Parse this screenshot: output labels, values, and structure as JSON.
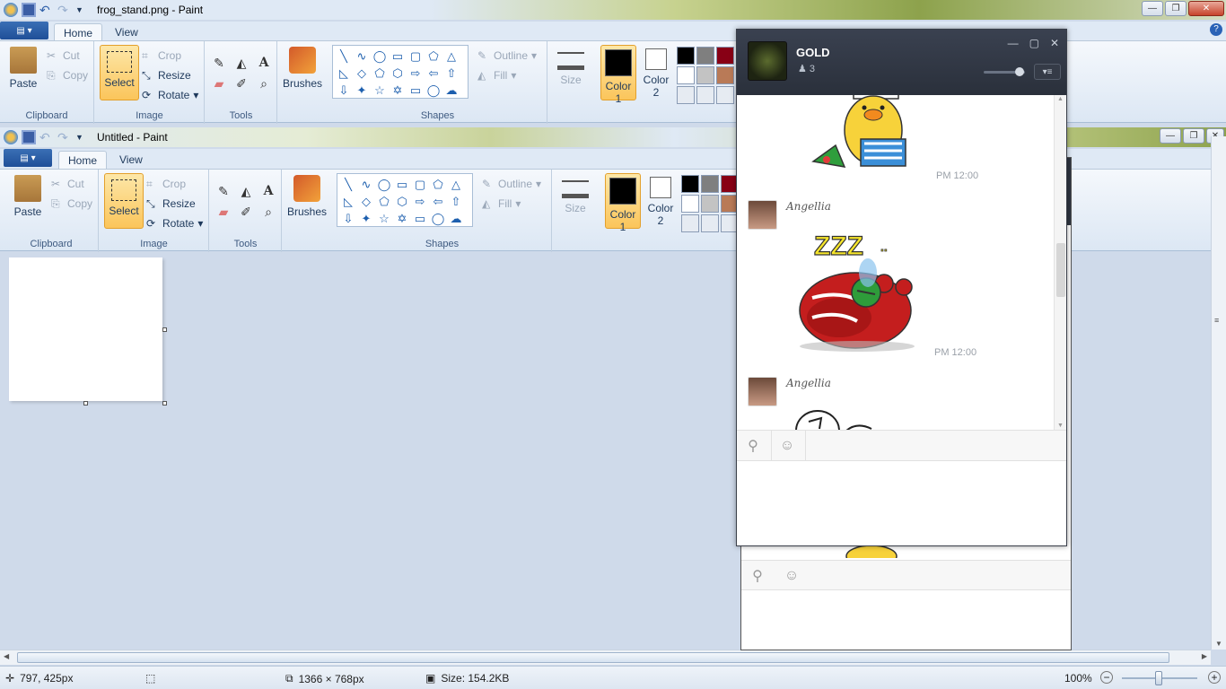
{
  "back_window": {
    "title": "frog_stand.png - Paint",
    "tabs": [
      "Home",
      "View"
    ],
    "groups": {
      "clipboard": "Clipboard",
      "image": "Image",
      "tools": "Tools",
      "shapes": "Shapes"
    },
    "buttons": {
      "paste": "Paste",
      "cut": "Cut",
      "copy": "Copy",
      "select": "Select",
      "crop": "Crop",
      "resize": "Resize",
      "rotate": "Rotate",
      "brushes": "Brushes",
      "outline": "Outline",
      "fill": "Fill",
      "size": "Size",
      "color1": "Color\n1",
      "color2": "Color\n2"
    }
  },
  "front_window": {
    "title": "Untitled - Paint",
    "tabs": [
      "Home",
      "View"
    ],
    "groups": {
      "clipboard": "Clipboard",
      "image": "Image",
      "tools": "Tools",
      "shapes": "Shapes"
    },
    "buttons": {
      "paste": "Paste",
      "cut": "Cut",
      "copy": "Copy",
      "select": "Select",
      "crop": "Crop",
      "resize": "Resize",
      "rotate": "Rotate",
      "brushes": "Brushes",
      "outline": "Outline",
      "fill": "Fill",
      "size": "Size",
      "color1": "Color\n1",
      "color2": "Color\n2"
    }
  },
  "palette": [
    "#000000",
    "#7f7f7f",
    "#880015",
    "#ffffff",
    "#c3c3c3",
    "#b97a57",
    "#e6ebf2",
    "#e6ebf2",
    "#e6ebf2"
  ],
  "status": {
    "cursor": "797, 425px",
    "dimensions": "1366 × 768px",
    "size": "Size: 154.2KB",
    "zoom": "100%"
  },
  "chat": {
    "title": "GOLD",
    "member_count": "3",
    "messages": [
      {
        "time": "PM 12:00"
      },
      {
        "sender": "Angellia",
        "time": "PM 12:00"
      },
      {
        "sender": "Angellia"
      }
    ]
  }
}
